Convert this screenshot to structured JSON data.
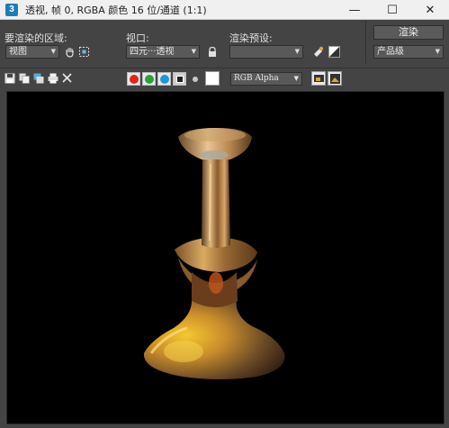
{
  "window": {
    "title": "透视, 帧 0, RGBA 颜色 16 位/通道 (1:1)",
    "app_icon": "3",
    "minimize_glyph": "—",
    "maximize_glyph": "☐",
    "close_glyph": "✕"
  },
  "panel": {
    "area_label": "要渲染的区域:",
    "area_value": "视图",
    "viewport_label": "视口:",
    "viewport_value": "四元···透视",
    "preset_label": "渲染预设:",
    "preset_value": "",
    "render_button": "渲染",
    "quality_value": "产品级"
  },
  "toolbar": {
    "channel_display": "RGB Alpha",
    "channels": [
      "red",
      "green",
      "blue",
      "alpha",
      "mono"
    ],
    "colors": {
      "red": "#e0241f",
      "green": "#28a23a",
      "blue": "#1a9bd7",
      "swatch": "#ffffff"
    }
  },
  "viewport": {
    "background": "#000000",
    "subject": "rendered golden glass vase"
  }
}
